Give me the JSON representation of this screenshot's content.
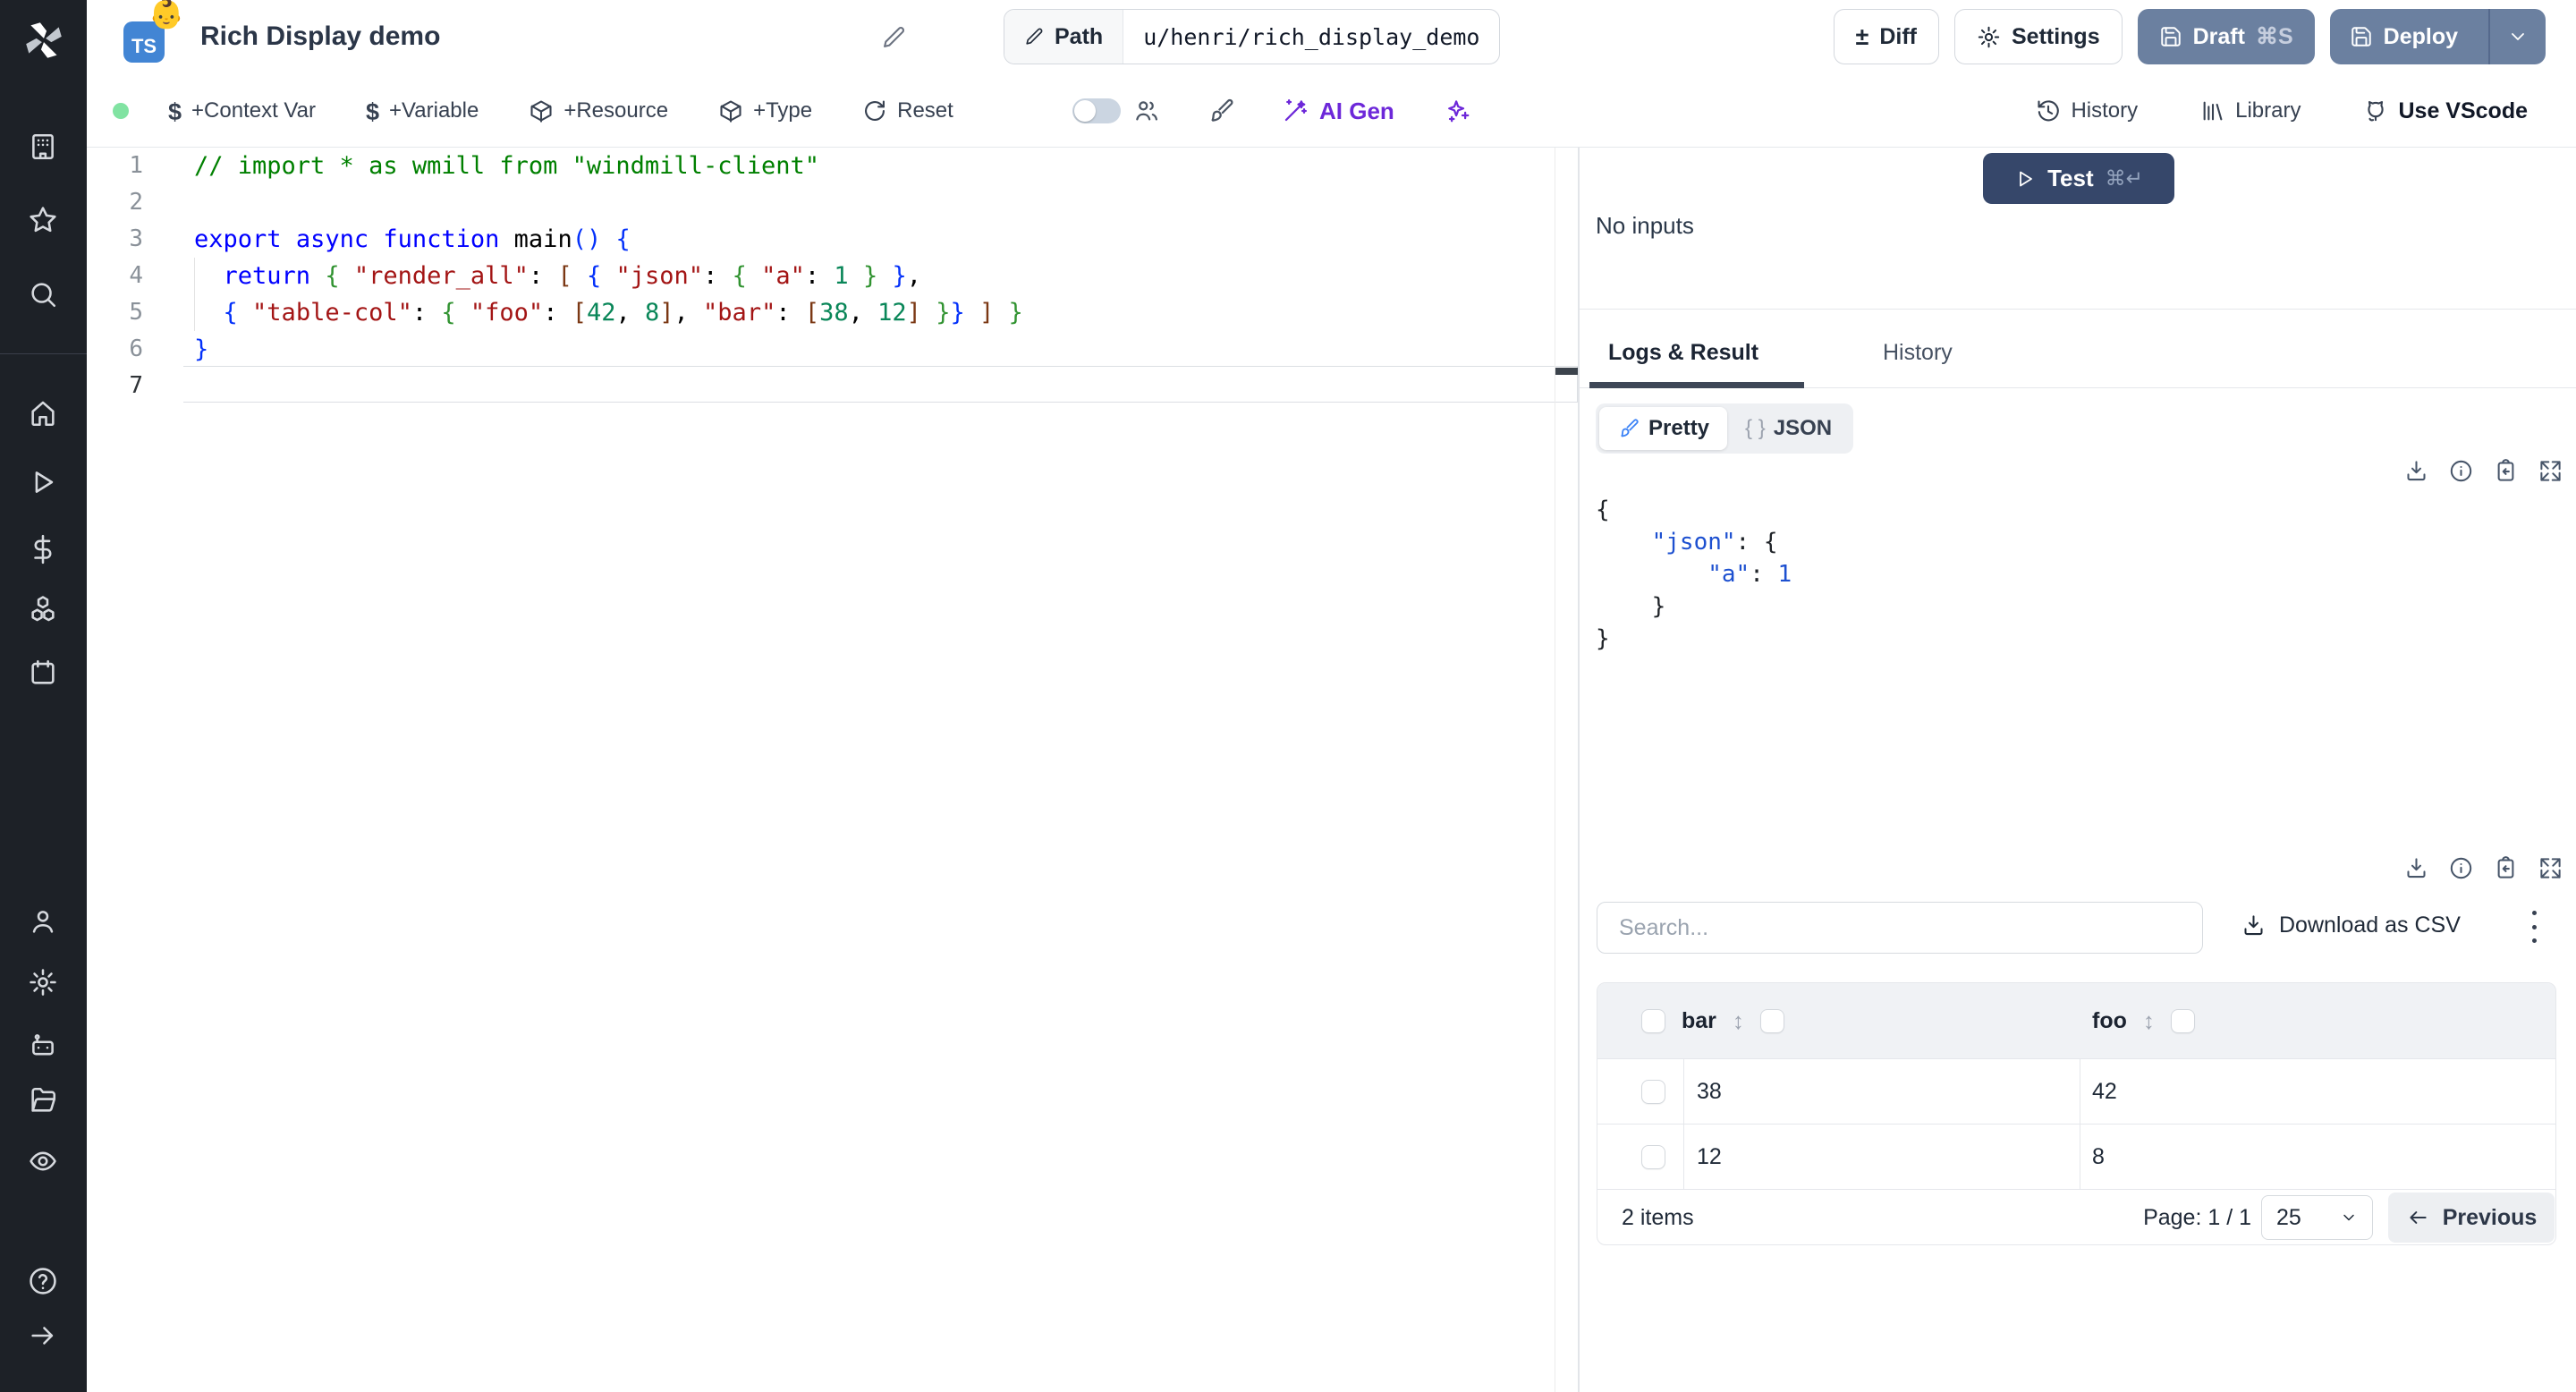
{
  "colors": {
    "button_slate": "#6b80a0",
    "test_navy": "#36476a",
    "ai_purple": "#6d28d9",
    "sync_green": "#81e3a2",
    "ts_badge_blue": "#4285d4",
    "sidebar_bg": "#1d2127"
  },
  "header": {
    "title": "Rich Display demo",
    "badge_text": "TS",
    "emoji": "👶",
    "path_label": "Path",
    "path_value": "u/henri/rich_display_demo",
    "diff_label": "Diff",
    "diff_glyph": "±",
    "settings_label": "Settings",
    "draft_label": "Draft",
    "draft_kbd": "⌘S",
    "deploy_label": "Deploy"
  },
  "toolbar": {
    "context_var": "+Context Var",
    "variable": "+Variable",
    "resource": "+Resource",
    "type": "+Type",
    "reset": "Reset",
    "ai_gen": "AI Gen",
    "history": "History",
    "library": "Library",
    "vscode": "Use VScode",
    "dollar_glyph": "$"
  },
  "editor": {
    "line_numbers": [
      "1",
      "2",
      "3",
      "4",
      "5",
      "6",
      "7"
    ],
    "lines": [
      {
        "tokens": [
          {
            "c": "cmt",
            "t": "// import * as wmill from \"windmill-client\""
          }
        ]
      },
      {
        "tokens": []
      },
      {
        "tokens": [
          {
            "c": "kw",
            "t": "export"
          },
          {
            "c": "pl",
            "t": " "
          },
          {
            "c": "kw",
            "t": "async"
          },
          {
            "c": "pl",
            "t": " "
          },
          {
            "c": "kw",
            "t": "function"
          },
          {
            "c": "pl",
            "t": " "
          },
          {
            "c": "pl",
            "t": "main"
          },
          {
            "c": "b1",
            "t": "()"
          },
          {
            "c": "pl",
            "t": " "
          },
          {
            "c": "b1",
            "t": "{"
          }
        ]
      },
      {
        "tokens": [
          {
            "c": "pl",
            "t": "  "
          },
          {
            "c": "kw",
            "t": "return"
          },
          {
            "c": "pl",
            "t": " "
          },
          {
            "c": "b2",
            "t": "{"
          },
          {
            "c": "pl",
            "t": " "
          },
          {
            "c": "str",
            "t": "\"render_all\""
          },
          {
            "c": "pl",
            "t": ": "
          },
          {
            "c": "b3",
            "t": "["
          },
          {
            "c": "pl",
            "t": " "
          },
          {
            "c": "b1",
            "t": "{"
          },
          {
            "c": "pl",
            "t": " "
          },
          {
            "c": "str",
            "t": "\"json\""
          },
          {
            "c": "pl",
            "t": ": "
          },
          {
            "c": "b2",
            "t": "{"
          },
          {
            "c": "pl",
            "t": " "
          },
          {
            "c": "str",
            "t": "\"a\""
          },
          {
            "c": "pl",
            "t": ": "
          },
          {
            "c": "num",
            "t": "1"
          },
          {
            "c": "pl",
            "t": " "
          },
          {
            "c": "b2",
            "t": "}"
          },
          {
            "c": "pl",
            "t": " "
          },
          {
            "c": "b1",
            "t": "}"
          },
          {
            "c": "pl",
            "t": ","
          }
        ]
      },
      {
        "tokens": [
          {
            "c": "pl",
            "t": "  "
          },
          {
            "c": "b1",
            "t": "{"
          },
          {
            "c": "pl",
            "t": " "
          },
          {
            "c": "str",
            "t": "\"table-col\""
          },
          {
            "c": "pl",
            "t": ": "
          },
          {
            "c": "b2",
            "t": "{"
          },
          {
            "c": "pl",
            "t": " "
          },
          {
            "c": "str",
            "t": "\"foo\""
          },
          {
            "c": "pl",
            "t": ": "
          },
          {
            "c": "b3",
            "t": "["
          },
          {
            "c": "num",
            "t": "42"
          },
          {
            "c": "pl",
            "t": ", "
          },
          {
            "c": "num",
            "t": "8"
          },
          {
            "c": "b3",
            "t": "]"
          },
          {
            "c": "pl",
            "t": ", "
          },
          {
            "c": "str",
            "t": "\"bar\""
          },
          {
            "c": "pl",
            "t": ": "
          },
          {
            "c": "b3",
            "t": "["
          },
          {
            "c": "num",
            "t": "38"
          },
          {
            "c": "pl",
            "t": ", "
          },
          {
            "c": "num",
            "t": "12"
          },
          {
            "c": "b3",
            "t": "]"
          },
          {
            "c": "pl",
            "t": " "
          },
          {
            "c": "b2",
            "t": "}"
          },
          {
            "c": "b1",
            "t": "}"
          },
          {
            "c": "pl",
            "t": " "
          },
          {
            "c": "b3",
            "t": "]"
          },
          {
            "c": "pl",
            "t": " "
          },
          {
            "c": "b2",
            "t": "}"
          }
        ]
      },
      {
        "tokens": [
          {
            "c": "b1",
            "t": "}"
          }
        ]
      },
      {
        "tokens": []
      }
    ]
  },
  "run": {
    "test_label": "Test",
    "test_kbd": "⌘↵",
    "no_inputs": "No inputs"
  },
  "tabs": {
    "logs_result": "Logs & Result",
    "history": "History"
  },
  "result": {
    "pretty_label": "Pretty",
    "json_label": "JSON",
    "json_glyph": "{ }",
    "json_lines": [
      {
        "tokens": [
          {
            "c": "jp",
            "t": "{"
          }
        ]
      },
      {
        "tokens": [
          {
            "c": "jp",
            "t": "    "
          },
          {
            "c": "jk",
            "t": "\"json\""
          },
          {
            "c": "jp",
            "t": ": {"
          }
        ]
      },
      {
        "tokens": [
          {
            "c": "jp",
            "t": "        "
          },
          {
            "c": "jk",
            "t": "\"a\""
          },
          {
            "c": "jp",
            "t": ": "
          },
          {
            "c": "jn",
            "t": "1"
          }
        ]
      },
      {
        "tokens": [
          {
            "c": "jp",
            "t": "    }"
          }
        ]
      },
      {
        "tokens": [
          {
            "c": "jp",
            "t": "}"
          }
        ]
      }
    ]
  },
  "table": {
    "search_placeholder": "Search...",
    "download_csv": "Download as CSV",
    "columns": [
      "bar",
      "foo"
    ],
    "sort_glyph": "↕",
    "rows": [
      {
        "bar": "38",
        "foo": "42"
      },
      {
        "bar": "12",
        "foo": "8"
      }
    ],
    "items_count": "2 items",
    "page_label": "Page: 1 / 1",
    "page_size": "25",
    "previous_label": "Previous"
  }
}
